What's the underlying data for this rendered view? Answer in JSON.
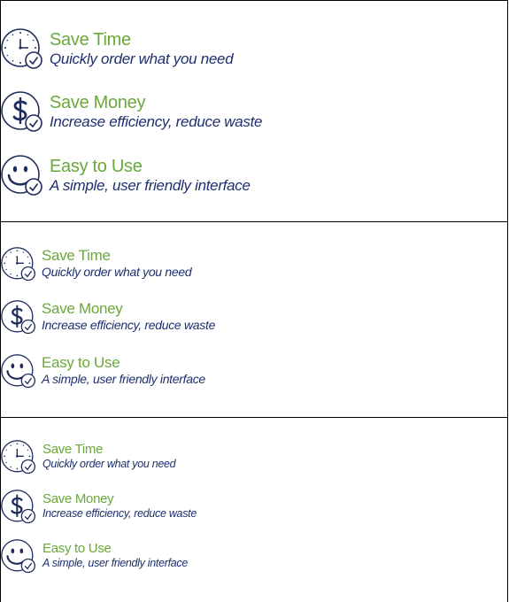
{
  "panels": [
    {
      "features": [
        {
          "icon": "clock-check-icon",
          "title": "Save Time",
          "subtitle": "Quickly order what you need"
        },
        {
          "icon": "dollar-check-icon",
          "title": "Save Money",
          "subtitle": "Increase efficiency, reduce waste"
        },
        {
          "icon": "smiley-check-icon",
          "title": "Easy to Use",
          "subtitle": "A simple, user friendly interface"
        }
      ]
    },
    {
      "features": [
        {
          "icon": "clock-check-icon",
          "title": "Save Time",
          "subtitle": "Quickly order what you need"
        },
        {
          "icon": "dollar-check-icon",
          "title": "Save Money",
          "subtitle": "Increase efficiency, reduce waste"
        },
        {
          "icon": "smiley-check-icon",
          "title": "Easy to Use",
          "subtitle": "A simple, user friendly interface"
        }
      ]
    },
    {
      "features": [
        {
          "icon": "clock-check-icon",
          "title": "Save Time",
          "subtitle": "Quickly order what you need"
        },
        {
          "icon": "dollar-check-icon",
          "title": "Save Money",
          "subtitle": "Increase efficiency, reduce waste"
        },
        {
          "icon": "smiley-check-icon",
          "title": "Easy to Use",
          "subtitle": "A simple, user friendly interface"
        }
      ]
    }
  ],
  "colors": {
    "title_green": "#6aa83b",
    "icon_navy": "#1f2d5c",
    "subtitle_navy": "#1d2f6e"
  }
}
